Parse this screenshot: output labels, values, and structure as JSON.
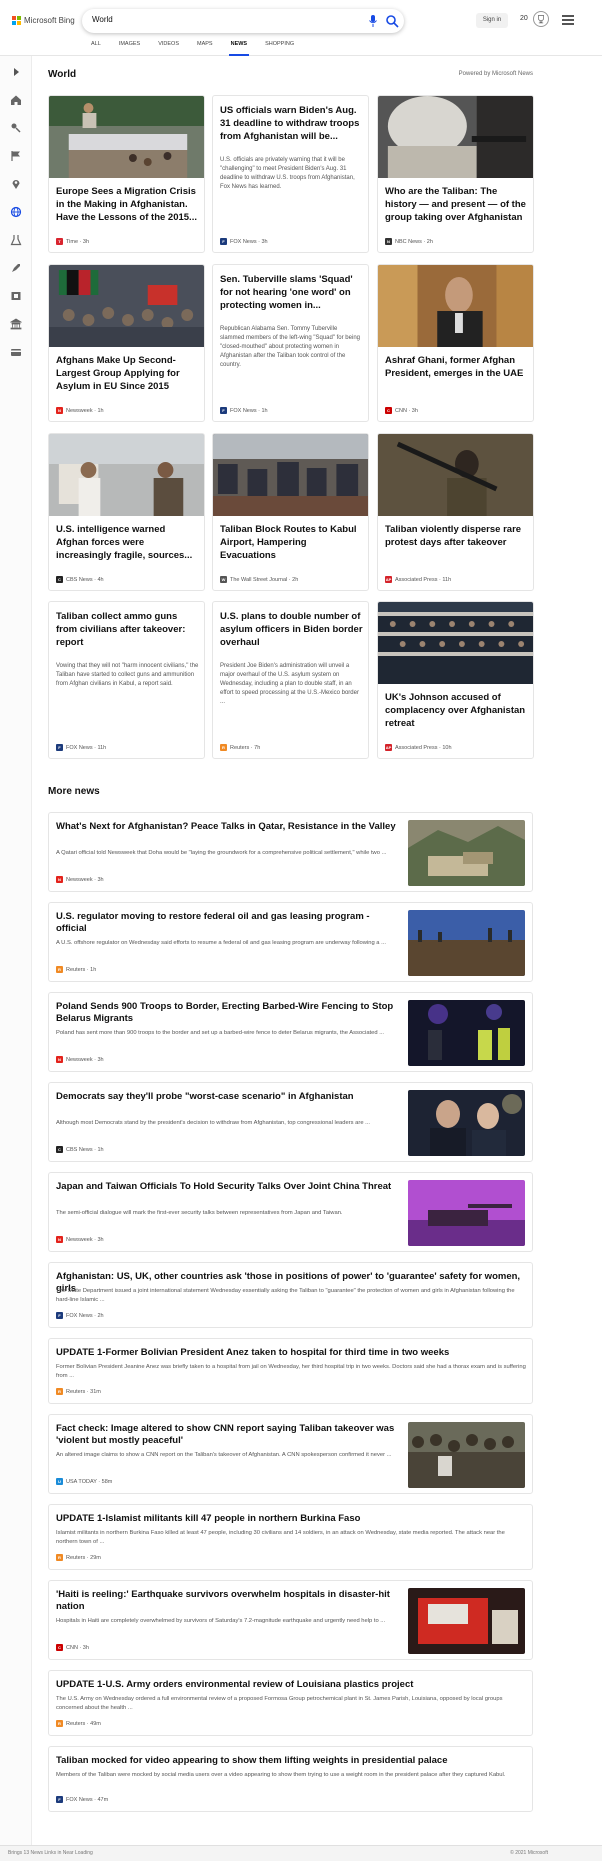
{
  "header": {
    "logo": "Microsoft Bing",
    "search_value": "World",
    "signin": "Sign in",
    "points": "20",
    "tabs": [
      "ALL",
      "IMAGES",
      "VIDEOS",
      "MAPS",
      "NEWS",
      "SHOPPING"
    ],
    "active_tab": "NEWS"
  },
  "rail_icons": [
    "chevron-right-icon",
    "home-icon",
    "sports-icon",
    "flag-icon",
    "location-pin-icon",
    "globe-icon",
    "science-icon",
    "rocket-icon",
    "film-icon",
    "bank-icon",
    "card-icon"
  ],
  "section": {
    "title": "World",
    "powered": "Powered by Microsoft News"
  },
  "cards": [
    {
      "title": "Europe Sees a Migration Crisis in the Making in Afghanistan. Have the Lessons of the 2015...",
      "snippet": "",
      "source": "Time",
      "time": "3h",
      "badge": "T",
      "badge_color": "#d9252f",
      "has_image": true,
      "img": "crowd"
    },
    {
      "title": "US officials warn Biden's Aug. 31 deadline to withdraw troops from Afghanistan will be...",
      "snippet": "U.S. officials are privately warning that it will be \"challenging\" to meet President Biden's Aug. 31 deadline to withdraw U.S. troops from Afghanistan, Fox News has learned.",
      "source": "FOX News",
      "time": "3h",
      "badge": "F",
      "badge_color": "#1c3b7c",
      "has_image": false
    },
    {
      "title": "Who are the Taliban: The history — and present — of the group taking over Afghanistan",
      "snippet": "",
      "source": "NBC News",
      "time": "2h",
      "badge": "N",
      "badge_color": "#333",
      "has_image": true,
      "img": "fighter"
    },
    {
      "title": "Afghans Make Up Second-Largest Group Applying for Asylum in EU Since 2015",
      "snippet": "",
      "source": "Newsweek",
      "time": "1h",
      "badge": "N",
      "badge_color": "#e3231c",
      "has_image": true,
      "img": "rally"
    },
    {
      "title": "Sen. Tuberville slams 'Squad' for not hearing 'one word' on protecting women in...",
      "snippet": "Republican Alabama Sen. Tommy Tuberville slammed members of the left-wing \"Squad\" for being \"closed-mouthed\" about protecting women in Afghanistan after the Taliban took control of the country.",
      "source": "FOX News",
      "time": "1h",
      "badge": "F",
      "badge_color": "#1c3b7c",
      "has_image": false
    },
    {
      "title": "Ashraf Ghani, former Afghan President, emerges in the UAE",
      "snippet": "",
      "source": "CNN",
      "time": "3h",
      "badge": "C",
      "badge_color": "#cc0000",
      "has_image": true,
      "img": "ghani"
    },
    {
      "title": "U.S. intelligence warned Afghan forces were increasingly fragile, sources...",
      "snippet": "",
      "source": "CBS News",
      "time": "4h",
      "badge": "C",
      "badge_color": "#222",
      "has_image": true,
      "img": "street"
    },
    {
      "title": "Taliban Block Routes to Kabul Airport, Hampering Evacuations",
      "snippet": "",
      "source": "The Wall Street Journal",
      "time": "2h",
      "badge": "W",
      "badge_color": "#555",
      "has_image": true,
      "img": "airport"
    },
    {
      "title": "Taliban violently disperse rare protest days after takeover",
      "snippet": "",
      "source": "Associated Press",
      "time": "11h",
      "badge": "AP",
      "badge_color": "#d4232a",
      "has_image": true,
      "img": "gunman"
    },
    {
      "title": "Taliban collect ammo guns from civilians after takeover: report",
      "snippet": "Vowing that they will not \"harm innocent civilians,\" the Taliban have started to collect guns and ammunition from Afghan civilians in Kabul, a report said.",
      "source": "FOX News",
      "time": "11h",
      "badge": "F",
      "badge_color": "#1c3b7c",
      "has_image": false
    },
    {
      "title": "U.S. plans to double number of asylum officers in Biden border overhaul",
      "snippet": "President Joe Biden's administration will unveil a major overhaul of the U.S. asylum system on Wednesday, including a plan to double staff, in an effort to speed processing at the U.S.-Mexico border ...",
      "source": "Reuters",
      "time": "7h",
      "badge": "R",
      "badge_color": "#f08a24",
      "has_image": false
    },
    {
      "title": "UK's Johnson accused of complacency over Afghanistan retreat",
      "snippet": "",
      "source": "Associated Press",
      "time": "10h",
      "badge": "AP",
      "badge_color": "#d4232a",
      "has_image": true,
      "img": "parliament"
    }
  ],
  "more_news": {
    "title": "More news",
    "items": [
      {
        "title": "What's Next for Afghanistan? Peace Talks in Qatar, Resistance in the Valley",
        "snippet": "A Qatari official told Newsweek that Doha would be \"laying the groundwork for a comprehensive political settlement,\" while two ...",
        "source": "Newsweek",
        "time": "3h",
        "badge": "N",
        "badge_color": "#e3231c",
        "img": "valley"
      },
      {
        "title": "U.S. regulator moving to restore federal oil and gas leasing program - official",
        "snippet": "A U.S. offshore regulator on Wednesday said efforts to resume a federal oil and gas leasing program are underway following a ...",
        "source": "Reuters",
        "time": "1h",
        "badge": "R",
        "badge_color": "#f08a24",
        "img": "field"
      },
      {
        "title": "Poland Sends 900 Troops to Border, Erecting Barbed-Wire Fencing to Stop Belarus Migrants",
        "snippet": "Poland has sent more than 900 troops to the border and set up a barbed-wire fence to deter Belarus migrants, the Associated ...",
        "source": "Newsweek",
        "time": "3h",
        "badge": "N",
        "badge_color": "#e3231c",
        "img": "night"
      },
      {
        "title": "Democrats say they'll probe \"worst-case scenario\" in Afghanistan",
        "snippet": "Although most Democrats stand by the president's decision to withdraw from Afghanistan, top congressional leaders are ...",
        "source": "CBS News",
        "time": "1h",
        "badge": "C",
        "badge_color": "#222",
        "img": "officials"
      },
      {
        "title": "Japan and Taiwan Officials To Hold Security Talks Over Joint China Threat",
        "snippet": "The semi-official dialogue will mark the first-ever security talks between representatives from Japan and Taiwan.",
        "source": "Newsweek",
        "time": "3h",
        "badge": "N",
        "badge_color": "#e3231c",
        "img": "tank"
      },
      {
        "title": "Afghanistan: US, UK, other countries ask 'those in positions of power' to 'guarantee' safety for women, girls",
        "snippet": "The State Department issued a joint international statement Wednesday essentially asking the Taliban to \"guarantee\" the protection of women and girls in Afghanistan following the hard-line Islamic ...",
        "source": "FOX News",
        "time": "2h",
        "badge": "F",
        "badge_color": "#1c3b7c",
        "img": ""
      },
      {
        "title": "UPDATE 1-Former Bolivian President Anez taken to hospital for third time in two weeks",
        "snippet": "Former Bolivian President Jeanine Anez was briefly taken to a hospital from jail on Wednesday, her third hospital trip in two weeks. Doctors said she had a thorax exam and is suffering from ...",
        "source": "Reuters",
        "time": "31m",
        "badge": "R",
        "badge_color": "#f08a24",
        "img": ""
      },
      {
        "title": "Fact check: Image altered to show CNN report saying Taliban takeover was 'violent but mostly peaceful'",
        "snippet": "An altered image claims to show a CNN report on the Taliban's takeover of Afghanistan. A CNN spokesperson confirmed it never ...",
        "source": "USA TODAY",
        "time": "58m",
        "badge": "U",
        "badge_color": "#1a8cd8",
        "img": "crowd2"
      },
      {
        "title": "UPDATE 1-Islamist militants kill 47 people in northern Burkina Faso",
        "snippet": "Islamist militants in northern Burkina Faso killed at least 47 people, including 30 civilians and 14 soldiers, in an attack on Wednesday, state media reported. The attack near the northern town of ...",
        "source": "Reuters",
        "time": "29m",
        "badge": "R",
        "badge_color": "#f08a24",
        "img": ""
      },
      {
        "title": "'Haiti is reeling:' Earthquake survivors overwhelm hospitals in disaster-hit nation",
        "snippet": "Hospitals in Haiti are completely overwhelmed by survivors of Saturday's 7.2-magnitude earthquake and urgently need help to ...",
        "source": "CNN",
        "time": "3h",
        "badge": "C",
        "badge_color": "#cc0000",
        "img": "ambulance"
      },
      {
        "title": "UPDATE 1-U.S. Army orders environmental review of Louisiana plastics project",
        "snippet": "The U.S. Army on Wednesday ordered a full environmental review of a proposed Formosa Group petrochemical plant in St. James Parish, Louisiana, opposed by local groups concerned about the health ...",
        "source": "Reuters",
        "time": "49m",
        "badge": "R",
        "badge_color": "#f08a24",
        "img": ""
      },
      {
        "title": "Taliban mocked for video appearing to show them lifting weights in presidential palace",
        "snippet": "Members of the Taliban were mocked by social media users over a video appearing to show them trying to use a weight room in the president palace after they captured Kabul.",
        "source": "FOX News",
        "time": "47m",
        "badge": "F",
        "badge_color": "#1c3b7c",
        "img": ""
      }
    ]
  },
  "footer": {
    "left": "Brings 13 News Links in Near Loading",
    "right": "© 2021 Microsoft"
  }
}
